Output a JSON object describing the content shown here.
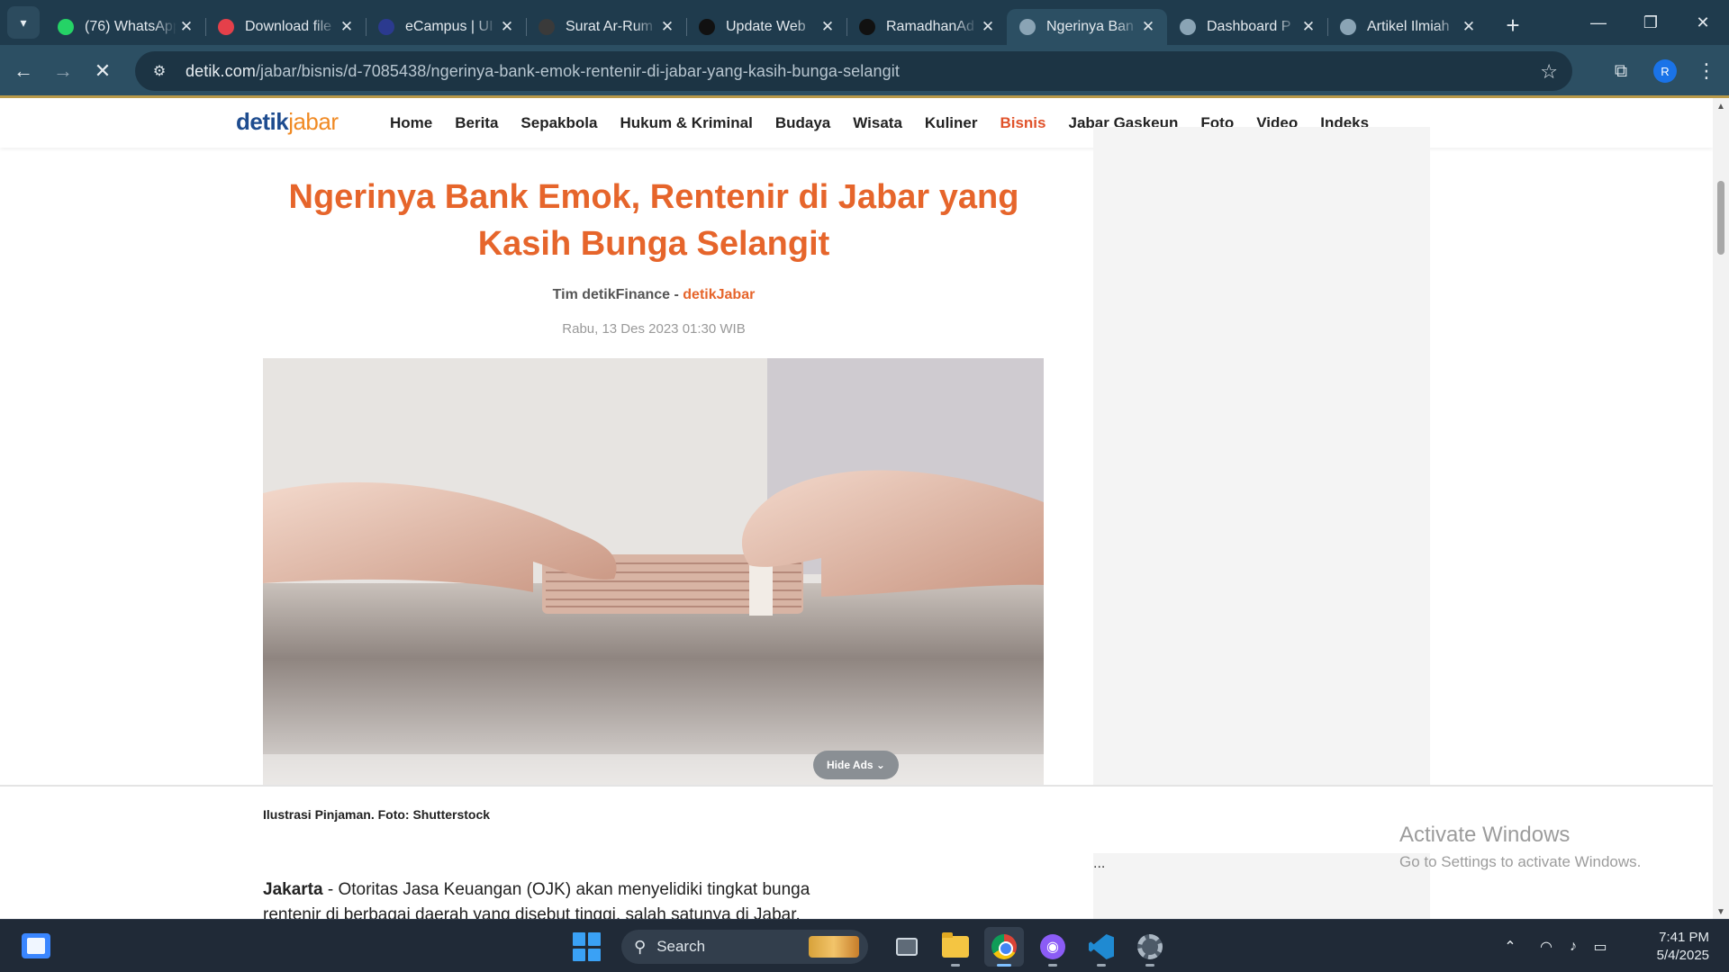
{
  "browser": {
    "tabs": [
      {
        "title": "(76) WhatsApp",
        "favicon": "whatsapp-icon",
        "color": "#25d366",
        "active": false
      },
      {
        "title": "Download file",
        "favicon": "heart-icon",
        "color": "#e5404a",
        "active": false
      },
      {
        "title": "eCampus | UI",
        "favicon": "campus-icon",
        "color": "#2b3a8f",
        "active": false
      },
      {
        "title": "Surat Ar-Rum",
        "favicon": "quran-icon",
        "color": "#3a3a3a",
        "active": false
      },
      {
        "title": "Update Web",
        "favicon": "openai-icon",
        "color": "#111111",
        "active": false
      },
      {
        "title": "RamadhanAd",
        "favicon": "github-icon",
        "color": "#111111",
        "active": false
      },
      {
        "title": "Ngerinya Ban",
        "favicon": "globe-icon",
        "color": "#8aa4b5",
        "active": true
      },
      {
        "title": "Dashboard P",
        "favicon": "globe-icon",
        "color": "#8aa4b5",
        "active": false
      },
      {
        "title": "Artikel Ilmiah",
        "favicon": "globe-icon",
        "color": "#8aa4b5",
        "active": false
      }
    ],
    "url_host": "detik.com",
    "url_path": "/jabar/bisnis/d-7085438/ngerinya-bank-emok-rentenir-di-jabar-yang-kasih-bunga-selangit",
    "profile_initial": "R"
  },
  "site": {
    "logo_a": "detik",
    "logo_b": "jabar",
    "nav": [
      "Home",
      "Berita",
      "Sepakbola",
      "Hukum & Kriminal",
      "Budaya",
      "Wisata",
      "Kuliner",
      "Bisnis",
      "Jabar Gaskeun",
      "Foto",
      "Video",
      "Indeks"
    ],
    "nav_active": "Bisnis"
  },
  "article": {
    "title": "Ngerinya Bank Emok, Rentenir di Jabar yang Kasih Bunga Selangit",
    "author": "Tim detikFinance",
    "separator": " - ",
    "source": "detikJabar",
    "date": "Rabu, 13 Des 2023 01:30 WIB",
    "hide_ads": "Hide Ads",
    "caption": "Ilustrasi Pinjaman. Foto: Shutterstock",
    "lead_city": "Jakarta",
    "lead_text": " - Otoritas Jasa Keuangan (OJK) akan menyelidiki tingkat bunga rentenir di berbagai daerah yang disebut tinggi, salah satunya di Jabar."
  },
  "sidebar": {
    "ellipsis": "..."
  },
  "watermark": {
    "line1": "Activate Windows",
    "line2": "Go to Settings to activate Windows."
  },
  "taskbar": {
    "search_label": "Search",
    "time": "7:41 PM",
    "date": "5/4/2025"
  },
  "colors": {
    "accent": "#e6652b",
    "brand_blue": "#1e4c8f",
    "brand_orange": "#f08a24"
  }
}
